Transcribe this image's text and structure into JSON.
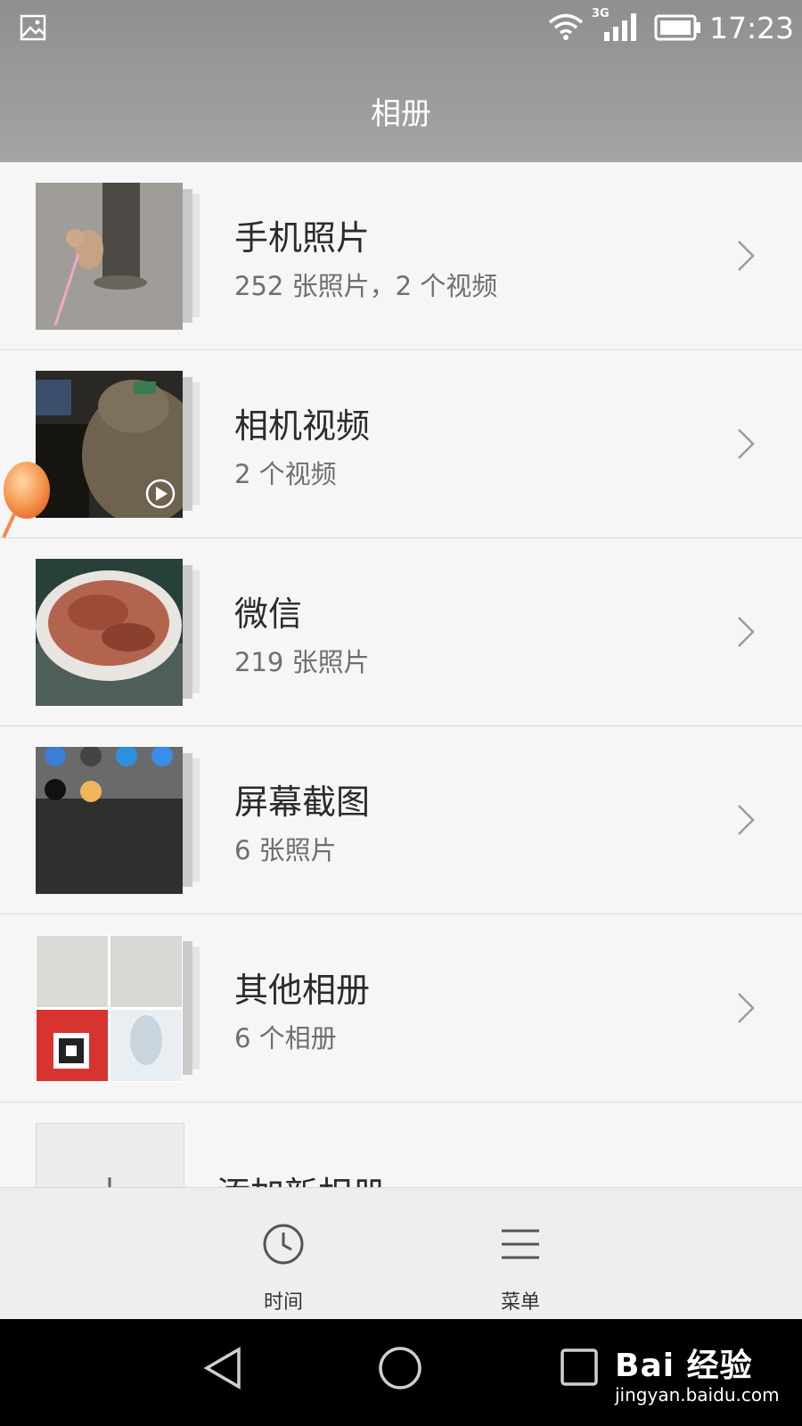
{
  "status_bar": {
    "time": "17:23",
    "network_type": "3G"
  },
  "header": {
    "title": "相册"
  },
  "albums": [
    {
      "name": "手机照片",
      "count": "252 张照片，2 个视频"
    },
    {
      "name": "相机视频",
      "count": "2 个视频"
    },
    {
      "name": "微信",
      "count": "219 张照片"
    },
    {
      "name": "屏幕截图",
      "count": "6 张照片"
    },
    {
      "name": "其他相册",
      "count": "6 个相册"
    },
    {
      "name": "添加新相册",
      "count": ""
    }
  ],
  "toolbar": {
    "time_label": "时间",
    "menu_label": "菜单"
  },
  "watermark": {
    "logo": "Bai 经验",
    "url": "jingyan.baidu.com"
  },
  "colors": {
    "header_bg": "#9a9a9a",
    "list_bg": "#f6f6f6",
    "nav_bg": "#000000"
  }
}
